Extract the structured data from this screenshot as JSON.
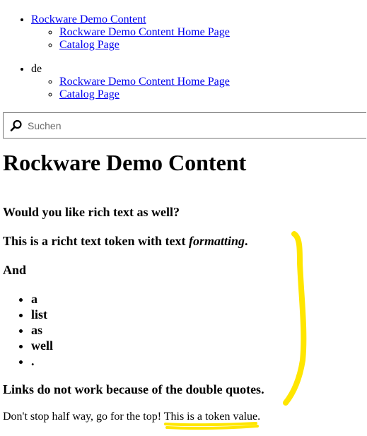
{
  "nav": {
    "sections": [
      {
        "label": "Rockware Demo Content",
        "is_link": true,
        "children": [
          {
            "label": "Rockware Demo Content Home Page"
          },
          {
            "label": "Catalog Page"
          }
        ]
      },
      {
        "label": "de",
        "is_link": false,
        "children": [
          {
            "label": "Rockware Demo Content Home Page"
          },
          {
            "label": "Catalog Page"
          }
        ]
      }
    ]
  },
  "search": {
    "placeholder": "Suchen",
    "value": "",
    "icon": "search-icon"
  },
  "page": {
    "title": "Rockware Demo Content"
  },
  "rich_text": {
    "question": "Would you like rich text as well?",
    "token_prefix": "This is a richt text token with text ",
    "token_em": "formatting",
    "token_suffix": ".",
    "and_label": "And",
    "list_items": [
      "a",
      "list",
      "as",
      "well",
      "."
    ],
    "links_note": "Links do not work because of the double quotes."
  },
  "footer": {
    "prefix": "Don't stop half way, go for the top! ",
    "token_value": "This is a token value",
    "suffix": "."
  },
  "annotation": {
    "color": "#ffe600"
  }
}
